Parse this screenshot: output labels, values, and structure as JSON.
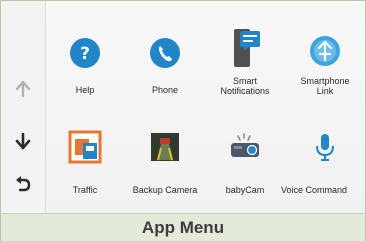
{
  "nav": {
    "up_icon": "up-arrow-icon",
    "down_icon": "down-arrow-icon",
    "back_icon": "back-arrow-icon"
  },
  "apps": [
    {
      "label": "Help",
      "icon": "help-icon"
    },
    {
      "label": "Phone",
      "icon": "phone-icon"
    },
    {
      "label": "Smart\nNotifications",
      "icon": "smart-notifications-icon"
    },
    {
      "label": "Smartphone\nLink",
      "icon": "smartphone-link-icon"
    },
    {
      "label": "Traffic",
      "icon": "traffic-icon"
    },
    {
      "label": "Backup Camera",
      "icon": "backup-camera-icon"
    },
    {
      "label": "babyCam",
      "icon": "babycam-icon"
    },
    {
      "label": "Voice Command",
      "icon": "voice-command-icon"
    }
  ],
  "caption": "App Menu",
  "colors": {
    "accent_blue": "#1f86c9",
    "traffic_orange": "#e8772e",
    "caption_bg": "#e3ead7"
  }
}
